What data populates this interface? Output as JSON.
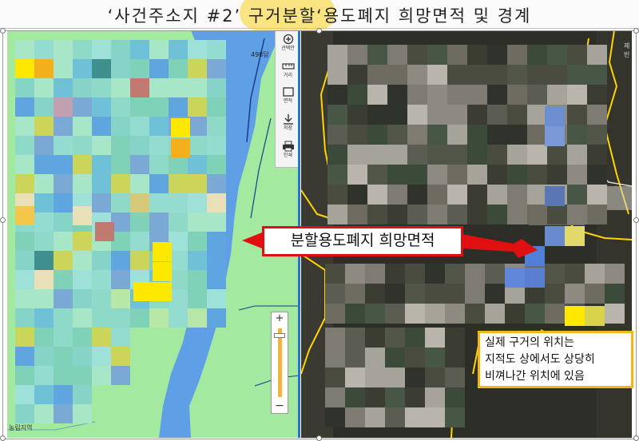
{
  "title": "‘사건주소지 #2’ 구거분할‘용도폐지 희망면적 및 경계",
  "left_map": {
    "area_label": "498답",
    "zone_label": "농림지역",
    "tools": [
      {
        "label": "선택안",
        "icon": "zoom-in-icon"
      },
      {
        "label": "거리",
        "icon": "ruler-icon"
      },
      {
        "label": "면적",
        "icon": "area-icon"
      },
      {
        "label": "저장",
        "icon": "download-icon"
      },
      {
        "label": "인쇄",
        "icon": "print-icon"
      }
    ],
    "zoom": {
      "plus": "+",
      "minus": "−",
      "level": 0.92
    }
  },
  "satellite": {
    "label": "제빈"
  },
  "callout": {
    "text": "분할용도폐지 희망면적",
    "color": "#e01010"
  },
  "note": {
    "lines": [
      "실제 구거의 위치는",
      "지적도 상에서도 상당히",
      "비껴나간 위치에 있음"
    ],
    "border_color": "#f2b619"
  },
  "colors": {
    "map_green": "#a3eaa0",
    "river_blue": "#5f9fe6",
    "divider_blue": "#2c6fd6",
    "parcel_yellow": "#ffe800"
  }
}
